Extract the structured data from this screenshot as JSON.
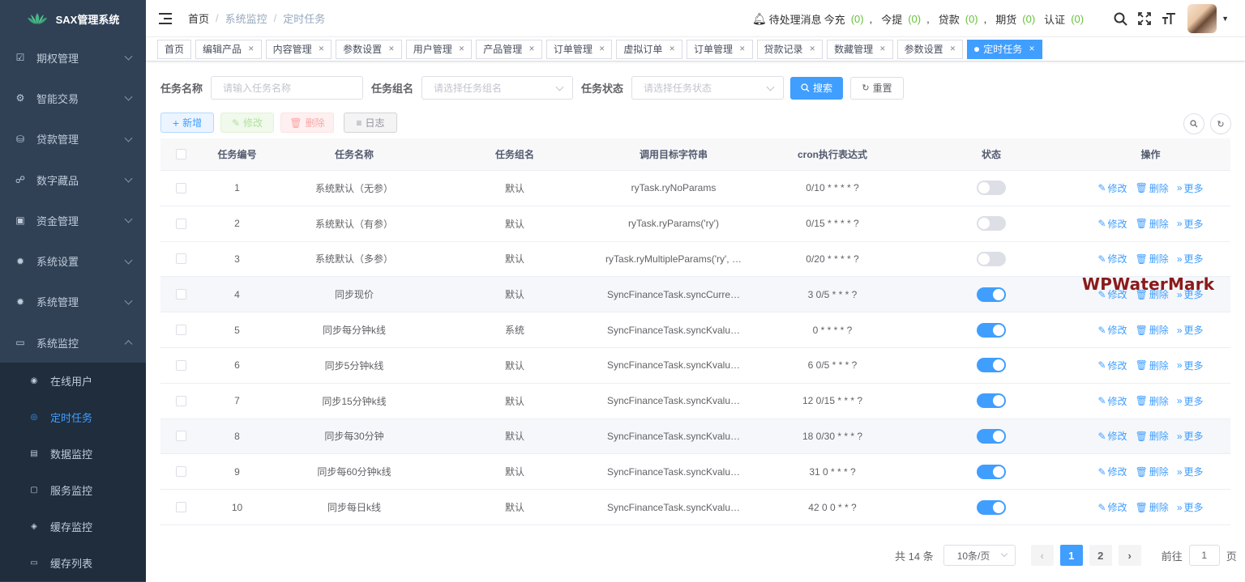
{
  "app": {
    "title": "SAX管理系统"
  },
  "sidebar": {
    "items": [
      {
        "label": "期权管理",
        "icon": "options-icon"
      },
      {
        "label": "智能交易",
        "icon": "trade-icon"
      },
      {
        "label": "贷款管理",
        "icon": "loan-icon"
      },
      {
        "label": "数字藏品",
        "icon": "collectible-icon"
      },
      {
        "label": "资金管理",
        "icon": "fund-icon"
      },
      {
        "label": "系统设置",
        "icon": "gear-icon"
      },
      {
        "label": "系统管理",
        "icon": "gear-icon"
      },
      {
        "label": "系统监控",
        "icon": "monitor-icon"
      }
    ],
    "sub_items": [
      {
        "label": "在线用户",
        "icon": "online-icon"
      },
      {
        "label": "定时任务",
        "icon": "job-icon",
        "active": true
      },
      {
        "label": "数据监控",
        "icon": "data-icon"
      },
      {
        "label": "服务监控",
        "icon": "server-icon"
      },
      {
        "label": "缓存监控",
        "icon": "redis-icon"
      },
      {
        "label": "缓存列表",
        "icon": "redis-list-icon"
      }
    ]
  },
  "navbar": {
    "breadcrumb": [
      "首页",
      "系统监控",
      "定时任务"
    ],
    "pending_label": "待处理消息",
    "pending": [
      {
        "label": "今充",
        "count": "(0)"
      },
      {
        "label": "今提",
        "count": "(0)"
      },
      {
        "label": "贷款",
        "count": "(0)"
      },
      {
        "label": "期货",
        "count": "(0)"
      },
      {
        "label": "认证",
        "count": "(0)"
      }
    ]
  },
  "tags": [
    "首页",
    "编辑产品",
    "内容管理",
    "参数设置",
    "用户管理",
    "产品管理",
    "订单管理",
    "虚拟订单",
    "订单管理",
    "贷款记录",
    "数藏管理",
    "参数设置",
    "定时任务"
  ],
  "search": {
    "job_name_label": "任务名称",
    "job_name_placeholder": "请输入任务名称",
    "job_group_label": "任务组名",
    "job_group_placeholder": "请选择任务组名",
    "status_label": "任务状态",
    "status_placeholder": "请选择任务状态",
    "search_btn": "搜索",
    "reset_btn": "重置"
  },
  "toolbar": {
    "add": "新增",
    "edit": "修改",
    "delete": "删除",
    "log": "日志"
  },
  "table": {
    "headers": [
      "任务编号",
      "任务名称",
      "任务组名",
      "调用目标字符串",
      "cron执行表达式",
      "状态",
      "操作"
    ],
    "ops": {
      "edit": "修改",
      "delete": "删除",
      "more": "更多"
    },
    "rows": [
      {
        "id": "1",
        "name": "系统默认（无参）",
        "group": "默认",
        "target": "ryTask.ryNoParams",
        "cron": "0/10 * * * * ?",
        "enabled": false
      },
      {
        "id": "2",
        "name": "系统默认（有参）",
        "group": "默认",
        "target": "ryTask.ryParams('ry')",
        "cron": "0/15 * * * * ?",
        "enabled": false
      },
      {
        "id": "3",
        "name": "系统默认（多参）",
        "group": "默认",
        "target": "ryTask.ryMultipleParams('ry', …",
        "cron": "0/20 * * * * ?",
        "enabled": false
      },
      {
        "id": "4",
        "name": "同步现价",
        "group": "默认",
        "target": "SyncFinanceTask.syncCurre…",
        "cron": "3 0/5 * * * ?",
        "enabled": true
      },
      {
        "id": "5",
        "name": "同步每分钟k线",
        "group": "系统",
        "target": "SyncFinanceTask.syncKvalu…",
        "cron": "0 * * * * ?",
        "enabled": true
      },
      {
        "id": "6",
        "name": "同步5分钟k线",
        "group": "默认",
        "target": "SyncFinanceTask.syncKvalu…",
        "cron": "6 0/5 * * * ?",
        "enabled": true
      },
      {
        "id": "7",
        "name": "同步15分钟k线",
        "group": "默认",
        "target": "SyncFinanceTask.syncKvalu…",
        "cron": "12 0/15 * * * ?",
        "enabled": true
      },
      {
        "id": "8",
        "name": "同步每30分钟",
        "group": "默认",
        "target": "SyncFinanceTask.syncKvalu…",
        "cron": "18 0/30 * * * ?",
        "enabled": true
      },
      {
        "id": "9",
        "name": "同步每60分钟k线",
        "group": "默认",
        "target": "SyncFinanceTask.syncKvalu…",
        "cron": "31 0 * * * ?",
        "enabled": true
      },
      {
        "id": "10",
        "name": "同步每日k线",
        "group": "默认",
        "target": "SyncFinanceTask.syncKvalu…",
        "cron": "42 0 0 * * ?",
        "enabled": true
      }
    ]
  },
  "watermark": "WPWaterMark",
  "pagination": {
    "total": "共 14 条",
    "page_size": "10条/页",
    "pages": [
      "1",
      "2"
    ],
    "current": "1",
    "goto_label": "前往",
    "goto_value": "1",
    "page_unit": "页"
  },
  "colors": {
    "primary": "#409eff",
    "sidebar_bg": "#304156",
    "success": "#67c23a"
  }
}
